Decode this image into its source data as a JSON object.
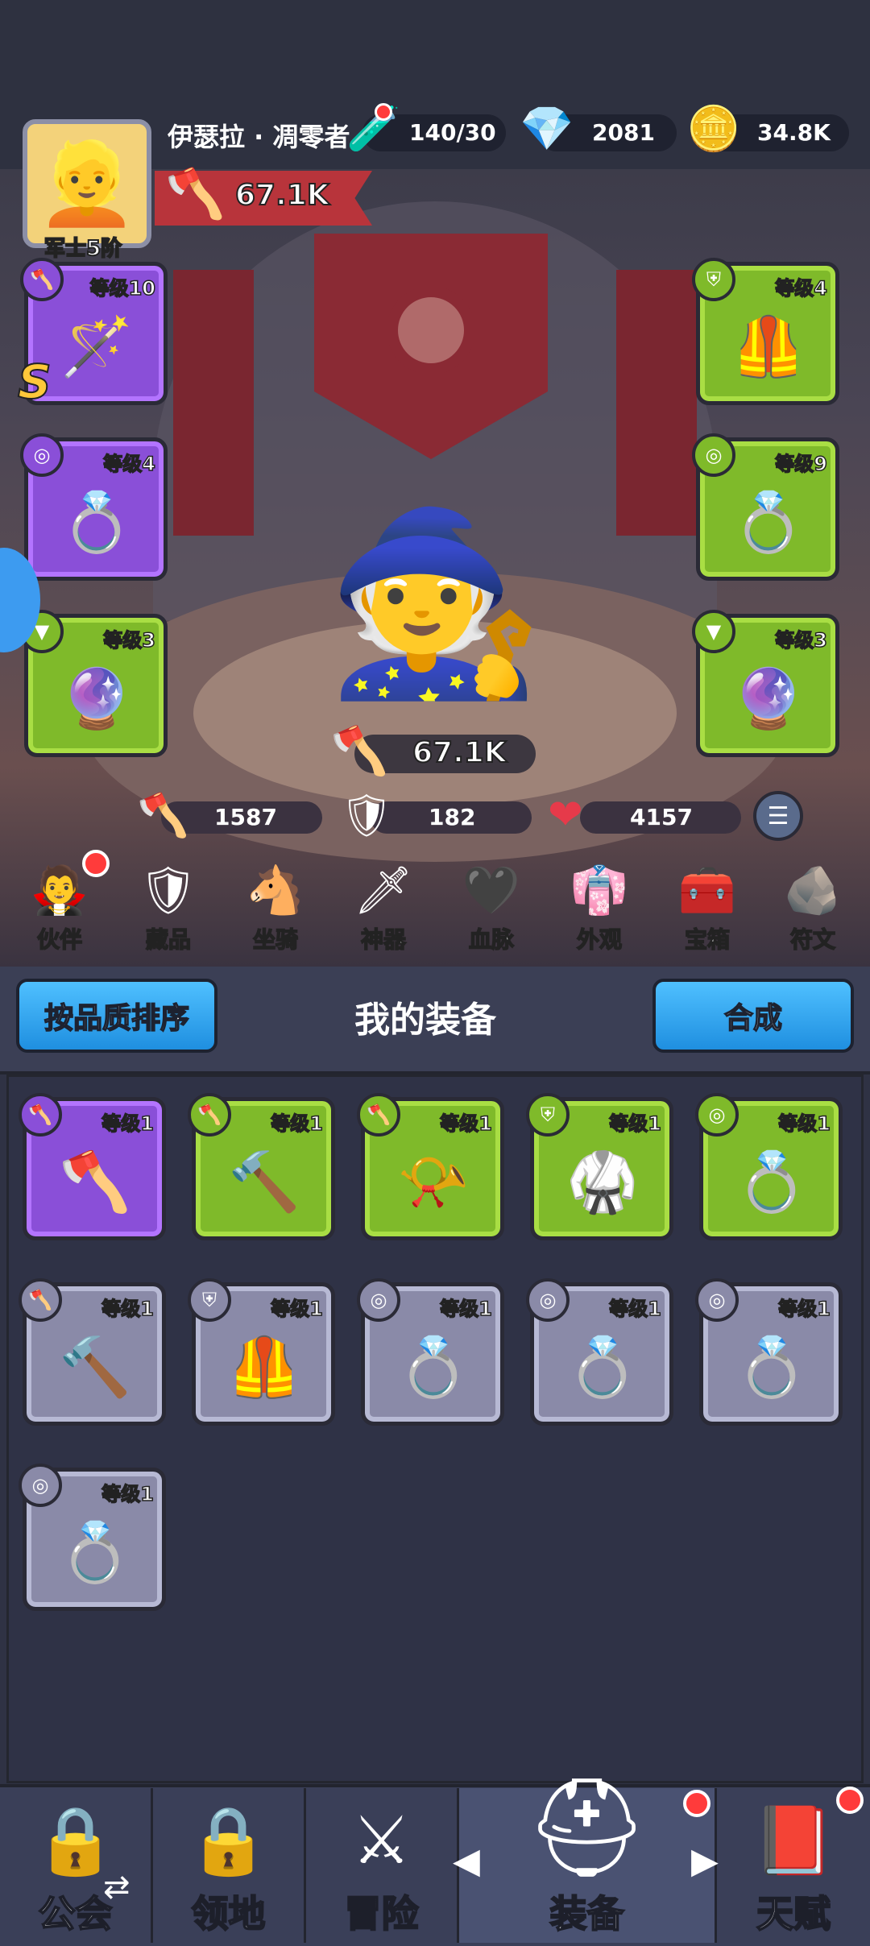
{
  "player": {
    "name": "伊瑟拉 · 凋零者",
    "rank": "军士5阶",
    "power": "67.1K"
  },
  "resources": {
    "energy": "140/30",
    "gems": "2081",
    "gold": "34.8K"
  },
  "equipped_left": [
    {
      "level": "等级10",
      "rarity_letter": "S",
      "icon": "staff-icon",
      "slot_icon": "axe-slot-icon"
    },
    {
      "level": "等级4",
      "icon": "ring-icon",
      "slot_icon": "ring-slot-icon"
    },
    {
      "level": "等级3",
      "icon": "amulet-icon",
      "slot_icon": "amulet-slot-icon"
    }
  ],
  "equipped_right": [
    {
      "level": "等级4",
      "icon": "armor-icon",
      "slot_icon": "armor-slot-icon"
    },
    {
      "level": "等级9",
      "icon": "ring-icon",
      "slot_icon": "ring-slot-icon"
    },
    {
      "level": "等级3",
      "icon": "amulet-icon",
      "slot_icon": "amulet-slot-icon"
    }
  ],
  "hero_power": "67.1K",
  "stats": {
    "attack": "1587",
    "defense": "182",
    "hp": "4157"
  },
  "nav": [
    {
      "label": "伙伴",
      "icon": "partner-icon"
    },
    {
      "label": "藏品",
      "icon": "collection-icon"
    },
    {
      "label": "坐骑",
      "icon": "mount-icon"
    },
    {
      "label": "神器",
      "icon": "artifact-icon"
    },
    {
      "label": "血脉",
      "icon": "bloodline-icon"
    },
    {
      "label": "外观",
      "icon": "appearance-icon"
    },
    {
      "label": "宝箱",
      "icon": "chest-icon"
    },
    {
      "label": "符文",
      "icon": "rune-icon"
    }
  ],
  "panel": {
    "sort_button": "按品质排序",
    "title": "我的装备",
    "merge_button": "合成"
  },
  "inventory": [
    {
      "level": "等级1",
      "rarity": "purple",
      "icon": "axe-icon"
    },
    {
      "level": "等级1",
      "rarity": "green",
      "icon": "hammer-icon"
    },
    {
      "level": "等级1",
      "rarity": "green",
      "icon": "horn-icon"
    },
    {
      "level": "等级1",
      "rarity": "green",
      "icon": "armor-icon"
    },
    {
      "level": "等级1",
      "rarity": "green",
      "icon": "ring-icon"
    },
    {
      "level": "等级1",
      "rarity": "grey",
      "icon": "hammer-icon"
    },
    {
      "level": "等级1",
      "rarity": "grey",
      "icon": "vest-icon"
    },
    {
      "level": "等级1",
      "rarity": "grey",
      "icon": "ring-icon"
    },
    {
      "level": "等级1",
      "rarity": "grey",
      "icon": "ring-icon"
    },
    {
      "level": "等级1",
      "rarity": "grey",
      "icon": "ring-icon"
    },
    {
      "level": "等级1",
      "rarity": "grey",
      "icon": "ring-icon"
    }
  ],
  "tabs": [
    {
      "label": "公会",
      "icon": "lock-icon"
    },
    {
      "label": "领地",
      "icon": "lock-icon"
    },
    {
      "label": "冒险",
      "icon": "crossed-axes-icon"
    },
    {
      "label": "装备",
      "icon": "helmet-icon"
    },
    {
      "label": "天赋",
      "icon": "talent-book-icon"
    }
  ]
}
